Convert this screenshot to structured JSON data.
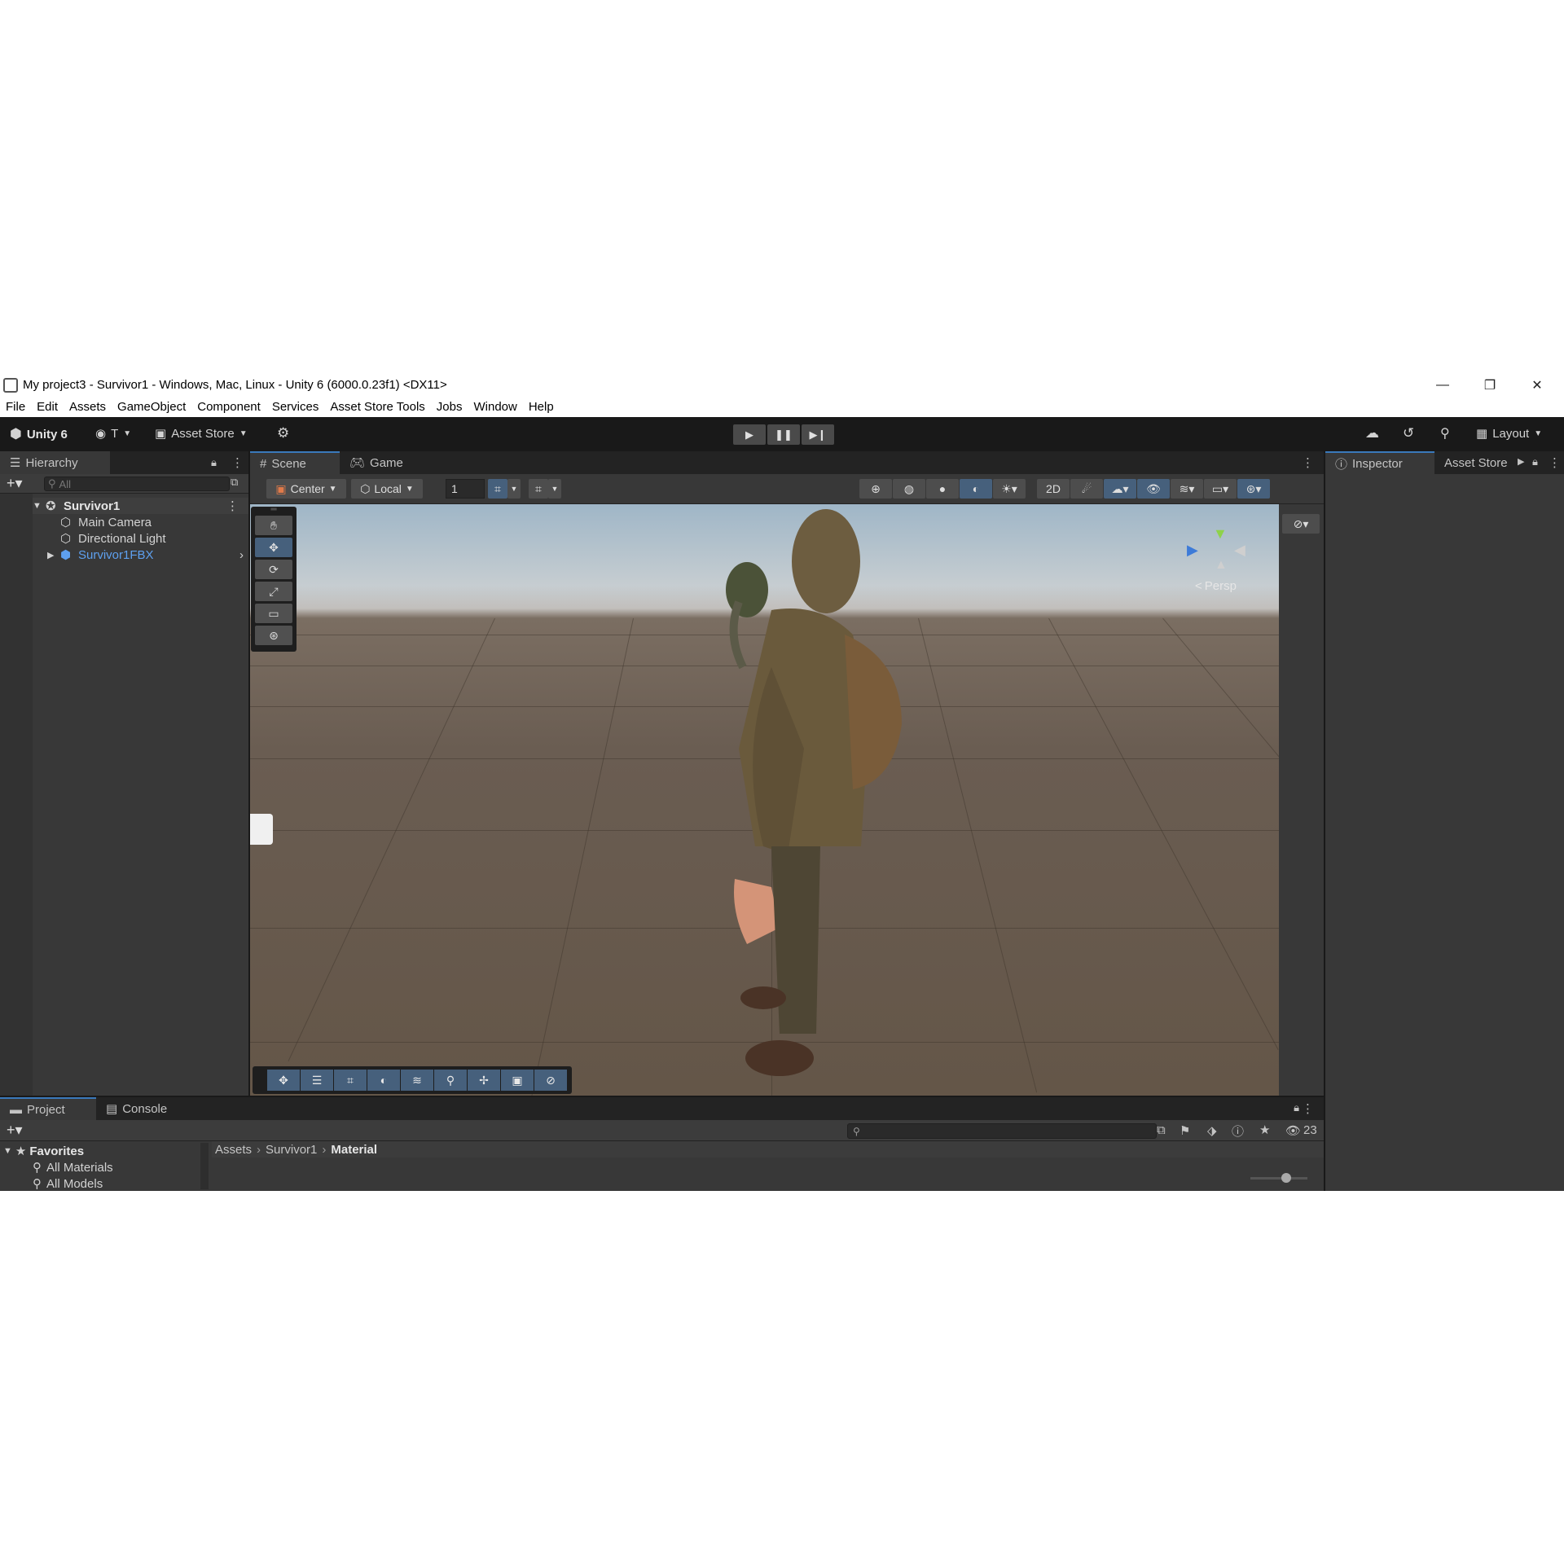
{
  "window": {
    "title": "My project3 - Survivor1 - Windows, Mac, Linux - Unity 6 (6000.0.23f1) <DX11>",
    "minimize": "—",
    "maximize": "❐",
    "close": "✕"
  },
  "menu": [
    "File",
    "Edit",
    "Assets",
    "GameObject",
    "Component",
    "Services",
    "Asset Store Tools",
    "Jobs",
    "Window",
    "Help"
  ],
  "toolbar": {
    "brand": "Unity 6",
    "account": "T",
    "asset_store": "Asset Store",
    "layout": "Layout"
  },
  "hierarchy": {
    "tab": "Hierarchy",
    "search_placeholder": "All",
    "scene": "Survivor1",
    "items": [
      "Main Camera",
      "Directional Light",
      "Survivor1FBX"
    ]
  },
  "scene": {
    "tabs": [
      "Scene",
      "Game"
    ],
    "pivot": "Center",
    "space": "Local",
    "snap_value": "1",
    "projection": "Persp"
  },
  "inspector": {
    "tabs": [
      "Inspector",
      "Asset Store"
    ]
  },
  "project": {
    "tabs": [
      "Project",
      "Console"
    ],
    "favorites_label": "Favorites",
    "favorites": [
      "All Materials",
      "All Models"
    ],
    "breadcrumb": [
      "Assets",
      "Survivor1",
      "Material"
    ],
    "hidden_count": "23"
  },
  "colors": {
    "accent": "#3a79bb",
    "selected_object": "#5ea0ef",
    "panel": "#383838"
  }
}
